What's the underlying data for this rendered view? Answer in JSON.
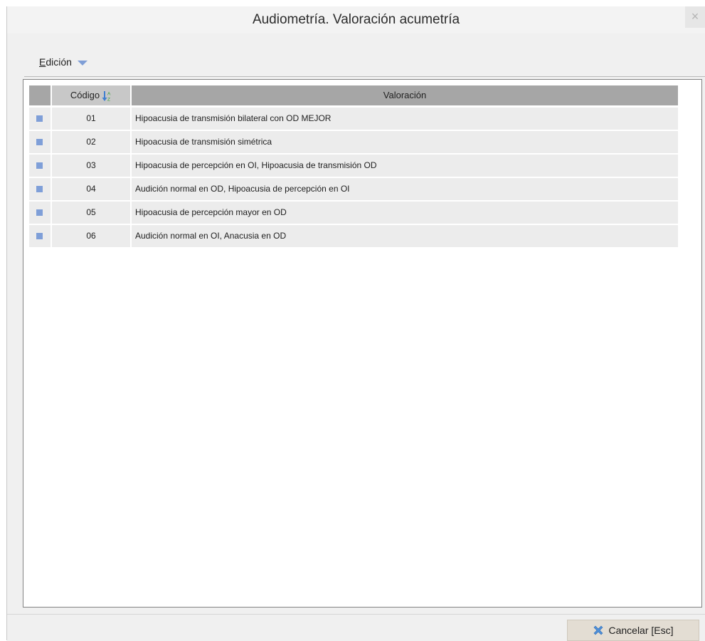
{
  "window": {
    "title": "Audiometría. Valoración acumetría",
    "close_label": "×"
  },
  "menu": {
    "edicion_mnemonic": "E",
    "edicion_rest": "dición"
  },
  "table": {
    "columns": {
      "code": "Código",
      "valuation": "Valoración"
    },
    "rows": [
      {
        "code": "01",
        "valuation": "Hipoacusia de transmisión bilateral con OD MEJOR"
      },
      {
        "code": "02",
        "valuation": "Hipoacusia de transmisión simétrica"
      },
      {
        "code": "03",
        "valuation": "Hipoacusia de percepción en OI, Hipoacusia de transmisión OD"
      },
      {
        "code": "04",
        "valuation": "Audición normal en OD, Hipoacusia de percepción en OI"
      },
      {
        "code": "05",
        "valuation": "Hipoacusia de percepción mayor en  OD"
      },
      {
        "code": "06",
        "valuation": "Audición normal en OI, Anacusia en OD"
      }
    ]
  },
  "footer": {
    "cancel_label": "Cancelar [Esc]"
  },
  "icons": {
    "sort": "sort-az-icon",
    "cancel": "cancel-x-icon",
    "dropdown": "chevron-down-icon",
    "row_marker": "row-marker-icon"
  },
  "colors": {
    "accent": "#7f9fd8",
    "header_bg": "#a6a6a6",
    "row_bg": "#ececec"
  }
}
